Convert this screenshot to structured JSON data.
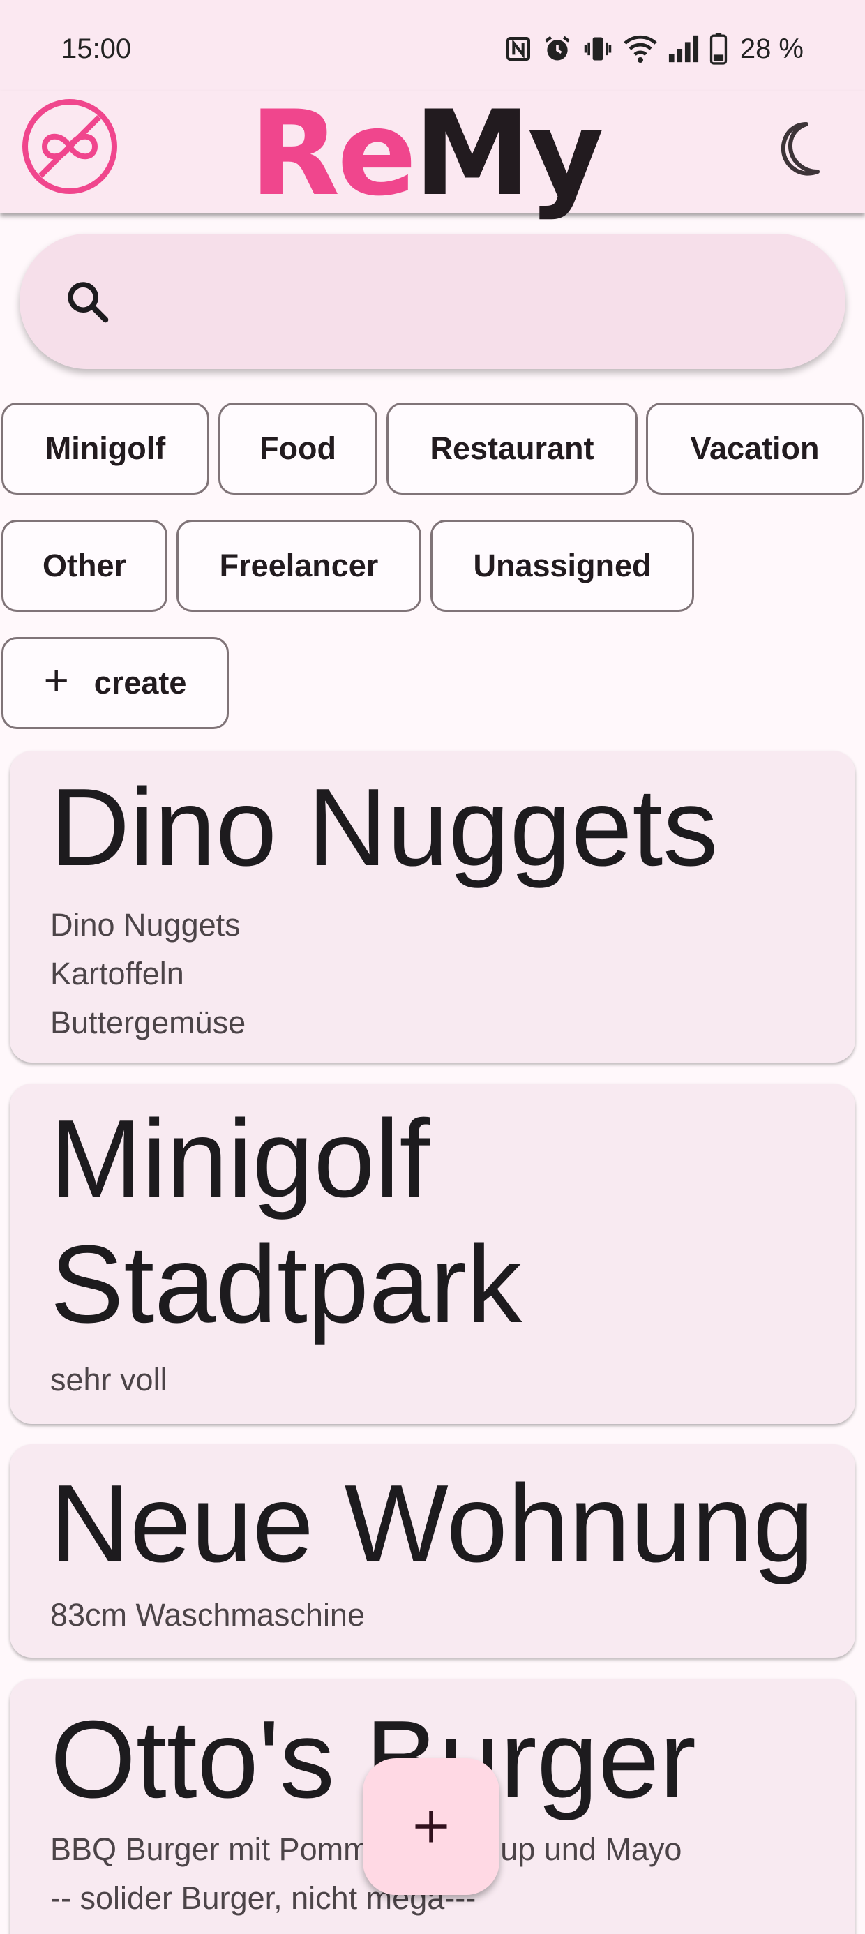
{
  "status_bar": {
    "time": "15:00",
    "battery": "28 %",
    "icons": [
      "nfc-icon",
      "alarm-icon",
      "vibrate-icon",
      "wifi-icon",
      "signal-icon",
      "battery-icon"
    ]
  },
  "app_bar": {
    "title_part1": "Re",
    "title_part2": "My",
    "logo_icon": "infinity-off-icon",
    "theme_icon": "moon-icon"
  },
  "search": {
    "placeholder": "",
    "value": "",
    "icon": "search-icon"
  },
  "chips": [
    {
      "label": "Minigolf"
    },
    {
      "label": "Food"
    },
    {
      "label": "Restaurant"
    },
    {
      "label": "Vacation"
    },
    {
      "label": "Other"
    },
    {
      "label": "Freelancer"
    },
    {
      "label": "Unassigned"
    }
  ],
  "create_chip": {
    "label": "create",
    "icon": "plus-icon"
  },
  "cards": [
    {
      "title": "Dino Nuggets",
      "description": "Dino Nuggets\nKartoffeln\nButtergemüse"
    },
    {
      "title": "Minigolf\nStadtpark",
      "description": "sehr voll"
    },
    {
      "title": "Neue Wohnung",
      "description": "83cm Waschmaschine"
    },
    {
      "title": "Otto's Burger",
      "description": "BBQ Burger mit Pommes, Ketchup und Mayo\n-- solider Burger, nicht mega---"
    }
  ],
  "fab": {
    "icon": "plus-icon"
  },
  "colors": {
    "accent": "#f0468d",
    "surface": "#fbe8f1",
    "card": "#f8eaf1",
    "fab": "#ffd9e4"
  }
}
